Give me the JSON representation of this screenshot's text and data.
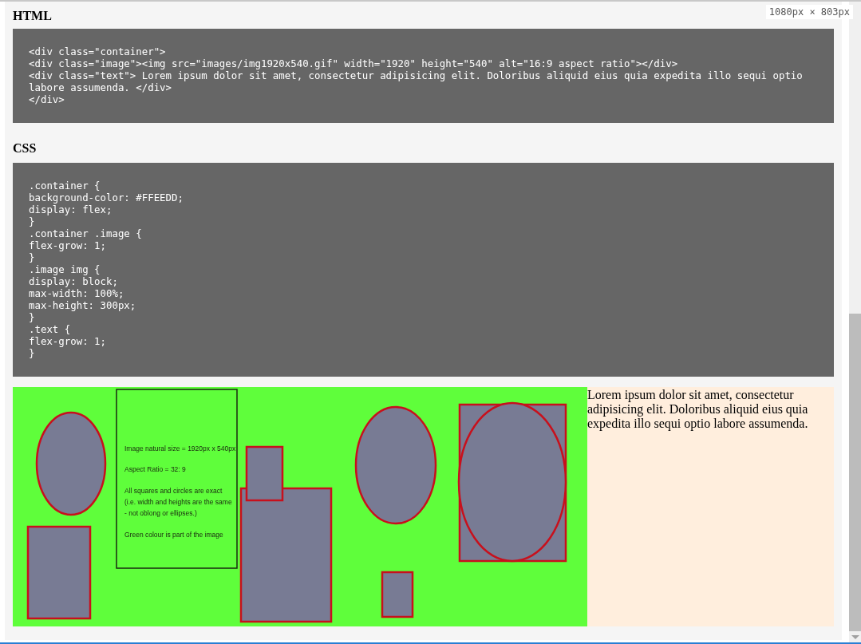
{
  "size_badge": "1080px × 803px",
  "sections": [
    {
      "heading": "HTML",
      "code": [
        "<div class=\"container\">",
        "<div class=\"image\"><img src=\"images/img1920x540.gif\" width=\"1920\" height=\"540\" alt=\"16:9 aspect ratio\"></div>",
        "<div class=\"text\"> Lorem ipsum dolor sit amet, consectetur adipisicing elit. Doloribus aliquid eius quia expedita illo sequi optio labore assumenda. </div>",
        "</div>"
      ]
    },
    {
      "heading": "CSS",
      "code": [
        ".container {",
        "background-color: #FFEEDD;",
        "display: flex;",
        "}",
        ".container .image {",
        "flex-grow: 1;",
        "}",
        ".image img {",
        "display: block;",
        "max-width: 100%;",
        "max-height: 300px;",
        "}",
        ".text {",
        "flex-grow: 1;",
        "}"
      ]
    }
  ],
  "demo": {
    "image_notes": [
      "Image natural size = 1920px x 540px",
      "Aspect Ratio = 32: 9",
      "All squares and circles are exact",
      "(i.e. width and heights are the same",
      "- not oblong or ellipses.)",
      "Green colour is part of the image"
    ],
    "text": "Lorem ipsum dolor sit amet, consectetur adipisicing elit. Doloribus aliquid eius quia expedita illo sequi optio labore assumenda."
  }
}
